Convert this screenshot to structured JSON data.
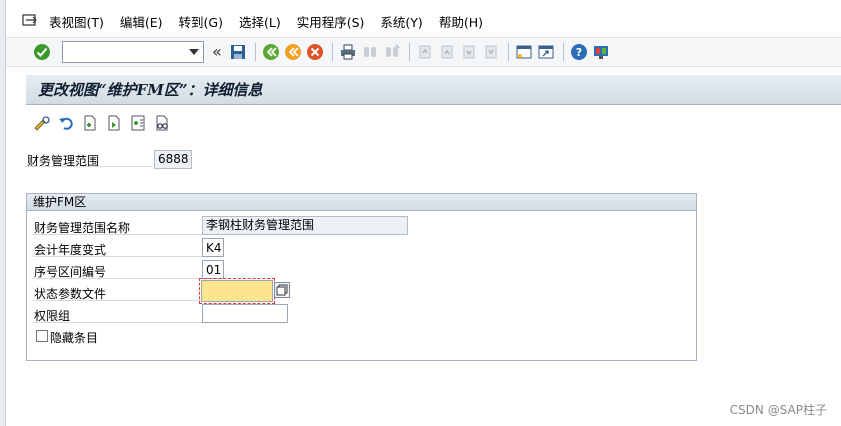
{
  "menubar": {
    "items": [
      "表视图(T)",
      "编辑(E)",
      "转到(G)",
      "选择(L)",
      "实用程序(S)",
      "系统(Y)",
      "帮助(H)"
    ]
  },
  "toolbar": {
    "command_field_value": "",
    "icons": [
      "enter-icon",
      "save-icon",
      "back-icon",
      "exit-icon",
      "cancel-icon",
      "print-icon",
      "find-icon",
      "find-next-icon",
      "first-page-icon",
      "previous-page-icon",
      "next-page-icon",
      "last-page-icon",
      "new-session-icon",
      "shortcut-icon",
      "help-icon",
      "layout-icon"
    ]
  },
  "title": "更改视图“维护FM区”：详细信息",
  "app_toolbar": {
    "icons": [
      "display-change-icon",
      "undo-icon",
      "previous-entry-icon",
      "next-entry-icon",
      "variable-list-icon",
      "select-all-icon"
    ]
  },
  "header_field": {
    "label": "财务管理范围",
    "value": "6888"
  },
  "group": {
    "title": "维护FM区",
    "fields": {
      "fm_area_name": {
        "label": "财务管理范围名称",
        "value": "李钢柱财务管理范围"
      },
      "fiscal_year_variant": {
        "label": "会计年度变式",
        "value": "K4"
      },
      "number_range": {
        "label": "序号区间编号",
        "value": "01"
      },
      "status_profile": {
        "label": "状态参数文件",
        "value": ""
      },
      "auth_group": {
        "label": "权限组",
        "value": ""
      },
      "hide_items": {
        "label": "隐藏条目",
        "checked": false
      }
    }
  },
  "watermark": "CSDN @SAP柱子",
  "colors": {
    "required_field_bg": "#fde590",
    "title_bg": "#dde4ea",
    "enter_green": "#3c9a2a"
  }
}
